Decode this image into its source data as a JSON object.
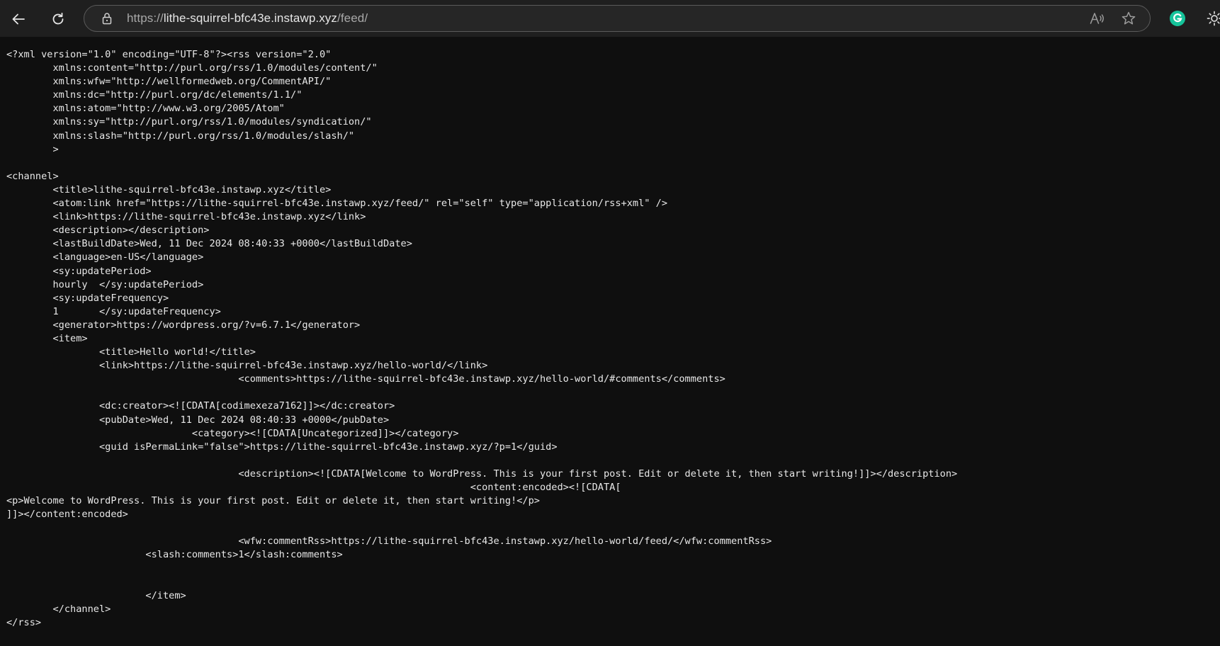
{
  "browser": {
    "url_scheme": "https://",
    "url_host": "lithe-squirrel-bfc43e.instawp.xyz",
    "url_path": "/feed/",
    "icons": {
      "back": "back-arrow-icon",
      "reload": "reload-icon",
      "lock": "lock-icon",
      "read_aloud": "read-aloud-icon",
      "favorite": "star-icon",
      "extension": "grammarly-icon",
      "settings": "gear-icon"
    },
    "colors": {
      "toolbar_bg": "#1f1f1f",
      "page_bg": "#0f0f0f",
      "text": "#e8e8e8",
      "grammarly": "#15c39a"
    }
  },
  "feed_lines": [
    "<?xml version=\"1.0\" encoding=\"UTF-8\"?><rss version=\"2.0\"",
    "\txmlns:content=\"http://purl.org/rss/1.0/modules/content/\"",
    "\txmlns:wfw=\"http://wellformedweb.org/CommentAPI/\"",
    "\txmlns:dc=\"http://purl.org/dc/elements/1.1/\"",
    "\txmlns:atom=\"http://www.w3.org/2005/Atom\"",
    "\txmlns:sy=\"http://purl.org/rss/1.0/modules/syndication/\"",
    "\txmlns:slash=\"http://purl.org/rss/1.0/modules/slash/\"",
    "\t>",
    "",
    "<channel>",
    "\t<title>lithe-squirrel-bfc43e.instawp.xyz</title>",
    "\t<atom:link href=\"https://lithe-squirrel-bfc43e.instawp.xyz/feed/\" rel=\"self\" type=\"application/rss+xml\" />",
    "\t<link>https://lithe-squirrel-bfc43e.instawp.xyz</link>",
    "\t<description></description>",
    "\t<lastBuildDate>Wed, 11 Dec 2024 08:40:33 +0000</lastBuildDate>",
    "\t<language>en-US</language>",
    "\t<sy:updatePeriod>",
    "\thourly\t</sy:updatePeriod>",
    "\t<sy:updateFrequency>",
    "\t1\t</sy:updateFrequency>",
    "\t<generator>https://wordpress.org/?v=6.7.1</generator>",
    "\t<item>",
    "\t\t<title>Hello world!</title>",
    "\t\t<link>https://lithe-squirrel-bfc43e.instawp.xyz/hello-world/</link>",
    "\t\t\t\t\t<comments>https://lithe-squirrel-bfc43e.instawp.xyz/hello-world/#comments</comments>",
    "",
    "\t\t<dc:creator><![CDATA[codimexeza7162]]></dc:creator>",
    "\t\t<pubDate>Wed, 11 Dec 2024 08:40:33 +0000</pubDate>",
    "\t\t\t\t<category><![CDATA[Uncategorized]]></category>",
    "\t\t<guid isPermaLink=\"false\">https://lithe-squirrel-bfc43e.instawp.xyz/?p=1</guid>",
    "",
    "\t\t\t\t\t<description><![CDATA[Welcome to WordPress. This is your first post. Edit or delete it, then start writing!]]></description>",
    "\t\t\t\t\t\t\t\t\t\t<content:encoded><![CDATA[",
    "<p>Welcome to WordPress. This is your first post. Edit or delete it, then start writing!</p>",
    "]]></content:encoded>",
    "",
    "\t\t\t\t\t<wfw:commentRss>https://lithe-squirrel-bfc43e.instawp.xyz/hello-world/feed/</wfw:commentRss>",
    "\t\t\t<slash:comments>1</slash:comments>",
    "",
    "",
    "\t\t\t</item>",
    "\t</channel>",
    "</rss>"
  ]
}
